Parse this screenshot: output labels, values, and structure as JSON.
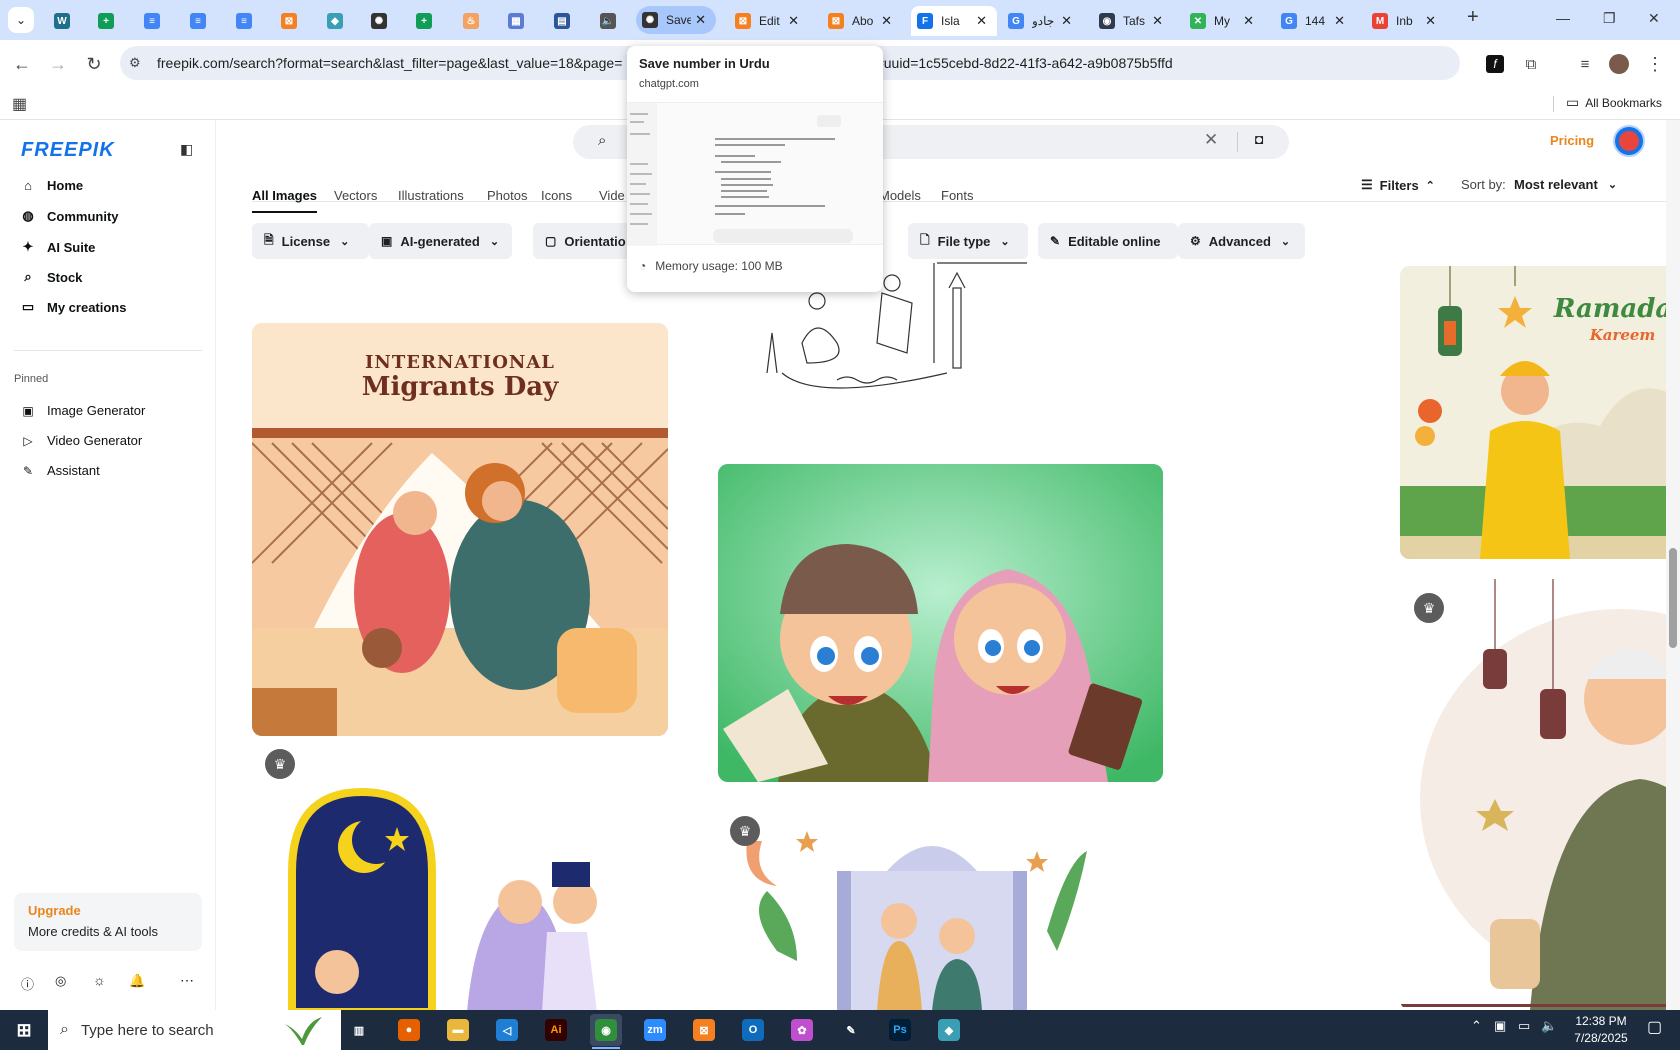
{
  "browser": {
    "tabs": [
      {
        "label": "",
        "fav": "#444",
        "glyph": "⌄"
      },
      {
        "label": "",
        "fav": "#1f6f8b",
        "glyph": "W"
      },
      {
        "label": "",
        "fav": "#0f9d58",
        "glyph": "+"
      },
      {
        "label": "",
        "fav": "#4285f4",
        "glyph": "≡"
      },
      {
        "label": "",
        "fav": "#4285f4",
        "glyph": "≡"
      },
      {
        "label": "",
        "fav": "#4285f4",
        "glyph": "≡"
      },
      {
        "label": "",
        "fav": "#f4801f",
        "glyph": "⊠"
      },
      {
        "label": "",
        "fav": "#3a9fb5",
        "glyph": "◆"
      },
      {
        "label": "",
        "fav": "#333",
        "glyph": "✺"
      },
      {
        "label": "",
        "fav": "#0f9d58",
        "glyph": "+"
      },
      {
        "label": "",
        "fav": "#f4a261",
        "glyph": "♨"
      },
      {
        "label": "",
        "fav": "#5b7bd5",
        "glyph": "▦"
      },
      {
        "label": "",
        "fav": "#2b5797",
        "glyph": "▤"
      },
      {
        "label": "",
        "fav": "#555",
        "glyph": "🔈"
      },
      {
        "label": "Save",
        "fav": "#333",
        "glyph": "✺"
      },
      {
        "label": "Edit",
        "fav": "#f4801f",
        "glyph": "⊠"
      },
      {
        "label": "Abo",
        "fav": "#f4801f",
        "glyph": "⊠"
      },
      {
        "label": "Isla",
        "fav": "#1273eb",
        "glyph": "F"
      },
      {
        "label": "جادو",
        "fav": "#4285f4",
        "glyph": "G"
      },
      {
        "label": "Tafs",
        "fav": "#2f3b4c",
        "glyph": "◉"
      },
      {
        "label": "My",
        "fav": "#32b35a",
        "glyph": "✕"
      },
      {
        "label": "144",
        "fav": "#4285f4",
        "glyph": "G"
      },
      {
        "label": "Inb",
        "fav": "#ea4335",
        "glyph": "M"
      }
    ],
    "new_tab": "+",
    "url": "freepik.com/search?format=search&last_filter=page&last_value=18&page=",
    "url_tail": "on#uuid=1c55cebd-8d22-41f3-a642-a9b0875b5ffd",
    "bookmarks_label": "All Bookmarks"
  },
  "tab_preview": {
    "title": "Save number in Urdu",
    "domain": "chatgpt.com",
    "memory": "Memory usage: 100 MB"
  },
  "sidebar": {
    "logo": "FREEPIK",
    "nav": [
      {
        "label": "Home",
        "icon": "⌂"
      },
      {
        "label": "Community",
        "icon": "◍"
      },
      {
        "label": "AI Suite",
        "icon": "✦"
      },
      {
        "label": "Stock",
        "icon": "⌕"
      },
      {
        "label": "My creations",
        "icon": "▭"
      }
    ],
    "pinned_title": "Pinned",
    "pinned": [
      {
        "label": "Image Generator",
        "icon": "▣"
      },
      {
        "label": "Video Generator",
        "icon": "▷"
      },
      {
        "label": "Assistant",
        "icon": "✎"
      }
    ],
    "upgrade_title": "Upgrade",
    "upgrade_sub": "More credits & AI tools"
  },
  "header": {
    "pricing": "Pricing"
  },
  "content_tabs": [
    "All Images",
    "Vectors",
    "Illustrations",
    "Photos",
    "Icons",
    "Vide",
    "Models",
    "Fonts"
  ],
  "filters": {
    "filters_label": "Filters",
    "sort_label": "Sort by:",
    "sort_value": "Most relevant",
    "chips": [
      {
        "label": "License",
        "icon": "🗎"
      },
      {
        "label": "AI-generated",
        "icon": "▣"
      },
      {
        "label": "Orientatio",
        "icon": "▢"
      },
      {
        "label": "File type",
        "icon": "🗋"
      },
      {
        "label": "Editable online",
        "icon": "✎"
      },
      {
        "label": "Advanced",
        "icon": "⚙"
      }
    ]
  },
  "cards": {
    "card1_line1": "INTERNATIONAL",
    "card1_line2": "Migrants Day",
    "card3_line1": "Ramadan",
    "card3_line2": "Kareem"
  },
  "taskbar": {
    "search_placeholder": "Type here to search",
    "time": "12:38 PM",
    "date": "7/28/2025"
  }
}
